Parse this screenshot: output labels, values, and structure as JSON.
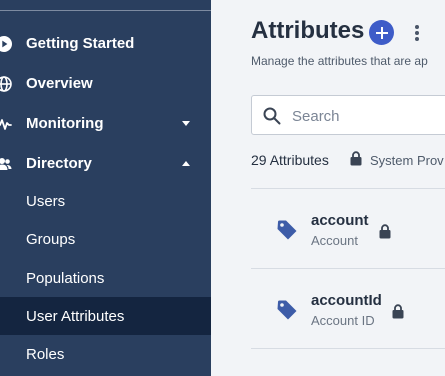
{
  "sidebar": {
    "items": [
      {
        "label": "Getting Started",
        "icon": "play-circle-icon"
      },
      {
        "label": "Overview",
        "icon": "globe-icon"
      },
      {
        "label": "Monitoring",
        "icon": "pulse-icon",
        "expanded": false
      },
      {
        "label": "Directory",
        "icon": "users-icon",
        "expanded": true
      }
    ],
    "sub_items": [
      {
        "label": "Users",
        "active": false
      },
      {
        "label": "Groups",
        "active": false
      },
      {
        "label": "Populations",
        "active": false
      },
      {
        "label": "User Attributes",
        "active": true
      },
      {
        "label": "Roles",
        "active": false
      }
    ]
  },
  "header": {
    "title": "Attributes",
    "subtitle": "Manage the attributes that are ap",
    "add_icon": "plus-icon",
    "more_icon": "more-vertical-icon"
  },
  "search": {
    "placeholder": "Search",
    "value": ""
  },
  "summary": {
    "count_text": "29 Attributes",
    "system_label": "System Prov"
  },
  "attributes": [
    {
      "name": "account",
      "display_name": "Account",
      "locked": true
    },
    {
      "name": "accountId",
      "display_name": "Account ID",
      "locked": true
    }
  ],
  "colors": {
    "sidebar_bg": "#2a3f5f",
    "sidebar_active": "#142540",
    "accent": "#3e5cc8",
    "tag_icon": "#3d5ca8",
    "text_dark": "#253041"
  }
}
